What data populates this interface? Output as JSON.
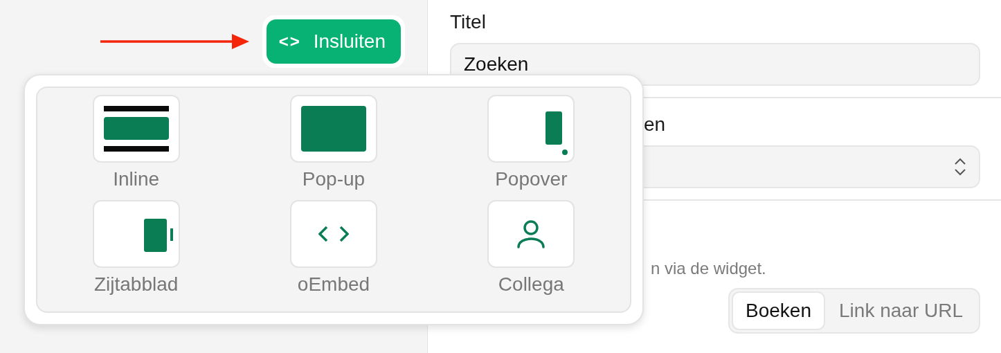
{
  "embed_button": {
    "label": "Insluiten",
    "icon": "<>"
  },
  "embed_menu": {
    "items": [
      {
        "label": "Inline",
        "kind": "inline"
      },
      {
        "label": "Pop-up",
        "kind": "popup"
      },
      {
        "label": "Popover",
        "kind": "popover"
      },
      {
        "label": "Zijtabblad",
        "kind": "sidetab"
      },
      {
        "label": "oEmbed",
        "kind": "code"
      },
      {
        "label": "Collega",
        "kind": "person"
      }
    ]
  },
  "form": {
    "title_label": "Titel",
    "title_value": "Zoeken",
    "second_label": "en",
    "hint": "n via de widget.",
    "action_options": [
      {
        "label": "Boeken",
        "selected": true
      },
      {
        "label": "Link naar URL",
        "selected": false
      }
    ]
  }
}
